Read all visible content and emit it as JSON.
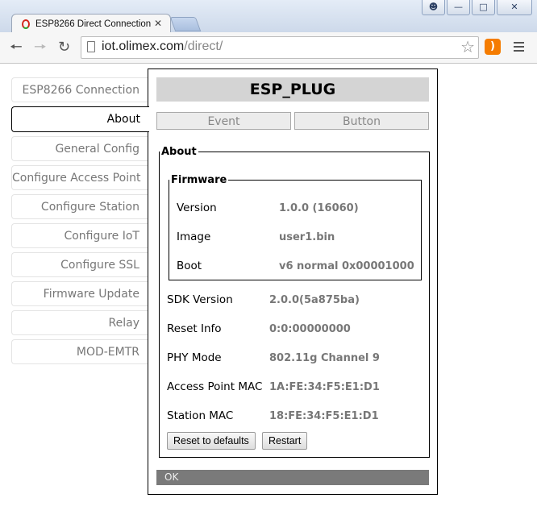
{
  "browser": {
    "tab_title": "ESP8266 Direct Connection",
    "url_domain": "iot.olimex.com",
    "url_path": "/direct/",
    "icons": [
      "back-icon",
      "forward-icon",
      "reload-icon",
      "page-icon",
      "star-icon",
      "rss-icon",
      "menu-icon"
    ]
  },
  "sidebar": {
    "items": [
      {
        "label": "ESP8266 Connection"
      },
      {
        "label": "About"
      },
      {
        "label": "General Config"
      },
      {
        "label": "Configure Access Point"
      },
      {
        "label": "Configure Station"
      },
      {
        "label": "Configure IoT"
      },
      {
        "label": "Configure SSL"
      },
      {
        "label": "Firmware Update"
      },
      {
        "label": "Relay"
      },
      {
        "label": "MOD-EMTR"
      }
    ],
    "active_index": 1
  },
  "panel": {
    "device_title": "ESP_PLUG",
    "tabs": [
      "Event",
      "Button"
    ],
    "about": {
      "legend": "About",
      "firmware": {
        "legend": "Firmware",
        "rows": [
          {
            "label": "Version",
            "value": "1.0.0 (16060)"
          },
          {
            "label": "Image",
            "value": "user1.bin"
          },
          {
            "label": "Boot",
            "value": "v6 normal 0x00001000"
          }
        ]
      },
      "rows": [
        {
          "label": "SDK Version",
          "value": "2.0.0(5a875ba)"
        },
        {
          "label": "Reset Info",
          "value": "0:0:00000000"
        },
        {
          "label": "PHY Mode",
          "value": "802.11g Channel 9"
        },
        {
          "label": "Access Point MAC",
          "value": "1A:FE:34:F5:E1:D1"
        },
        {
          "label": "Station MAC",
          "value": "18:FE:34:F5:E1:D1"
        }
      ],
      "buttons": {
        "reset": "Reset to defaults",
        "restart": "Restart"
      }
    },
    "status": "OK"
  }
}
